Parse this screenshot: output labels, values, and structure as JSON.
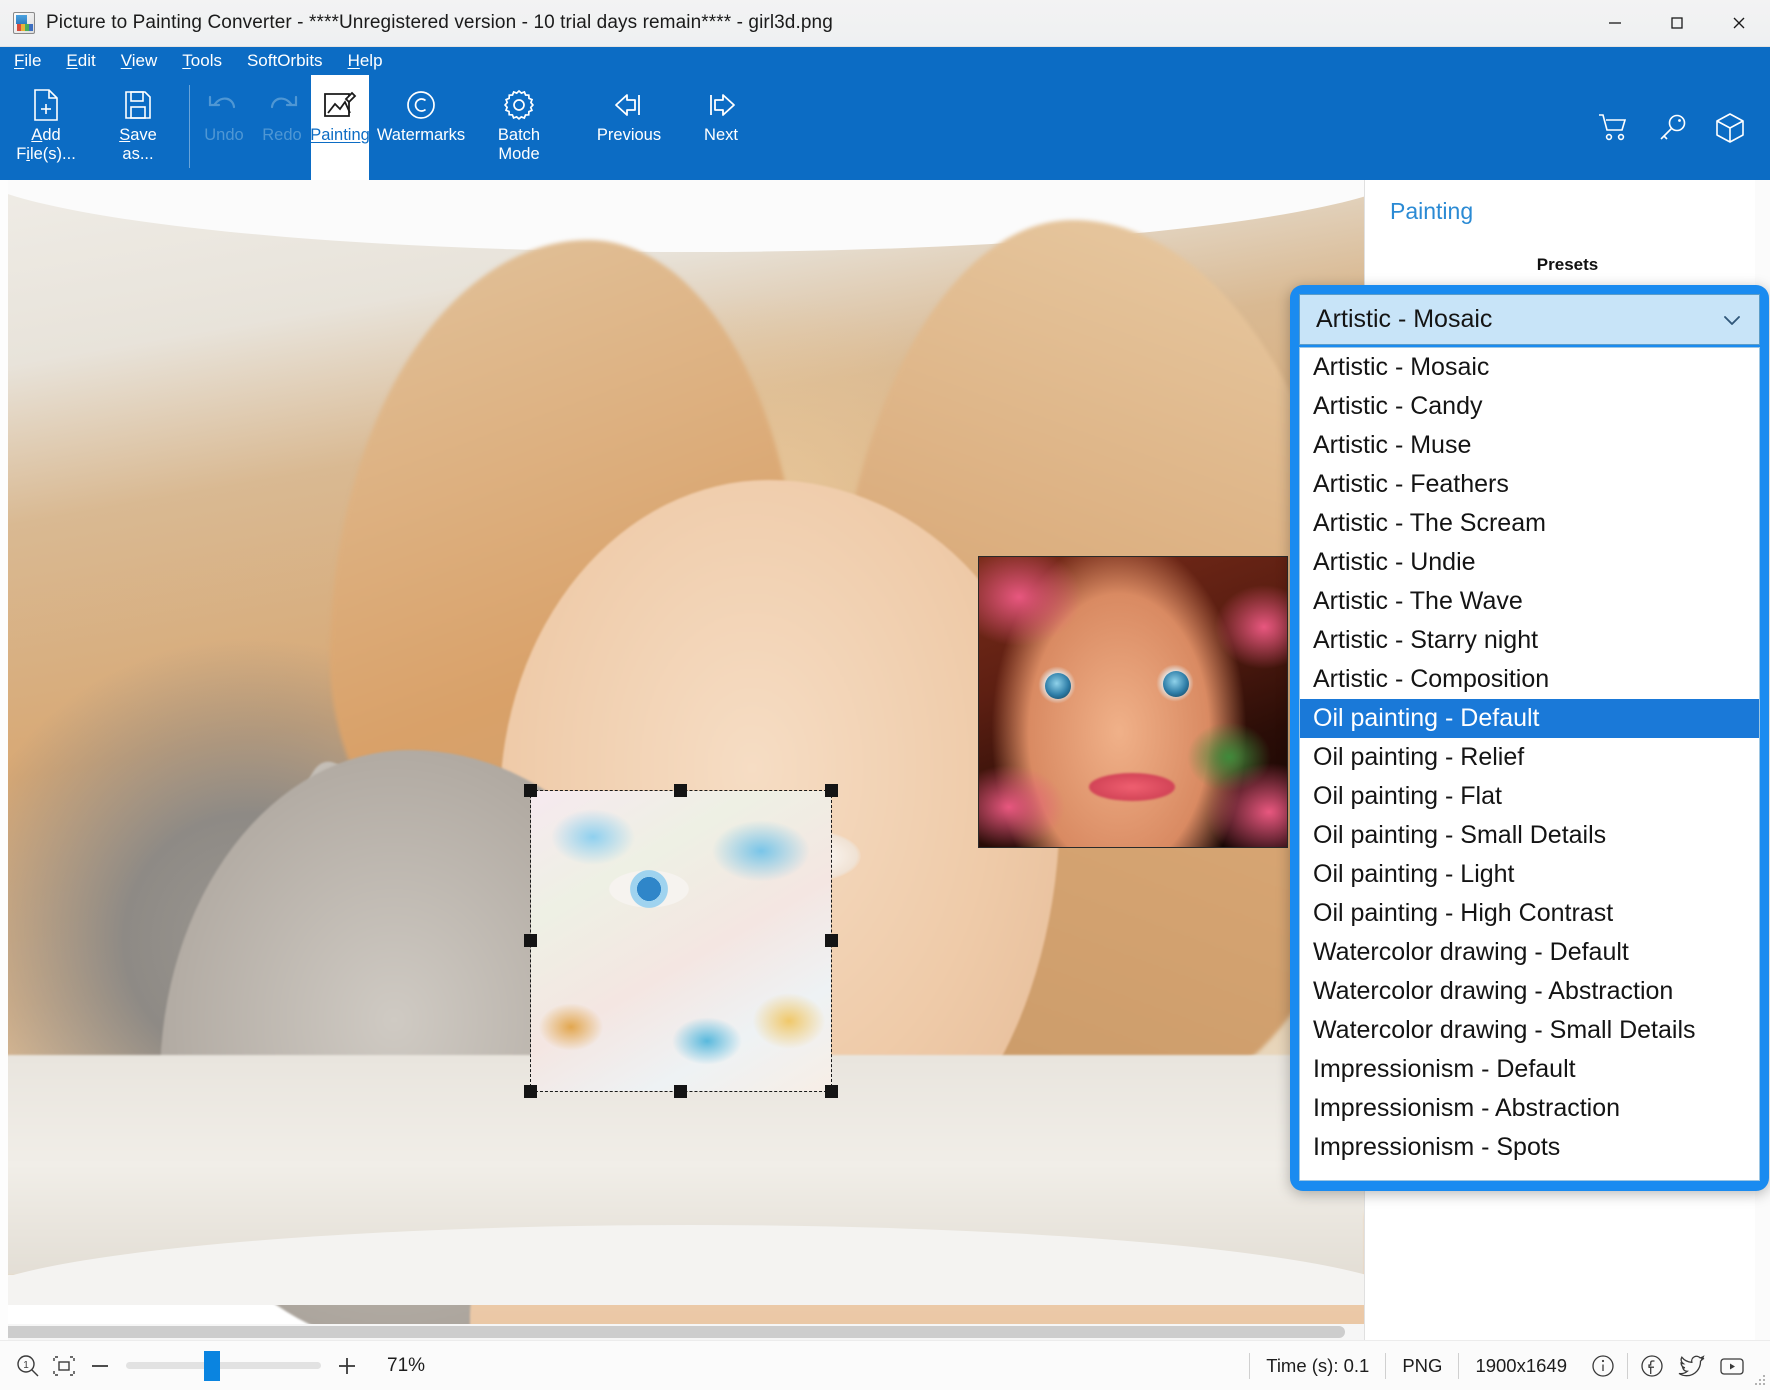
{
  "window": {
    "title": "Picture to Painting Converter - ****Unregistered version - 10 trial days remain**** - girl3d.png",
    "app_icon": "app-icon",
    "controls": {
      "minimize": "minimize-icon",
      "maximize": "maximize-icon",
      "close": "close-icon"
    }
  },
  "menu": [
    {
      "label": "File",
      "accel": "F"
    },
    {
      "label": "Edit",
      "accel": "E"
    },
    {
      "label": "View",
      "accel": "V"
    },
    {
      "label": "Tools",
      "accel": "T"
    },
    {
      "label": "SoftOrbits",
      "accel": ""
    },
    {
      "label": "Help",
      "accel": "H"
    }
  ],
  "toolbar": {
    "buttons": [
      {
        "label": "Add File(s)...",
        "icon": "add-file-icon",
        "state": "enabled"
      },
      {
        "label": "Save as...",
        "icon": "save-icon",
        "state": "enabled"
      },
      {
        "label": "Undo",
        "icon": "undo-icon",
        "state": "disabled"
      },
      {
        "label": "Redo",
        "icon": "redo-icon",
        "state": "disabled"
      },
      {
        "label": "Painting",
        "icon": "painting-icon",
        "state": "active"
      },
      {
        "label": "Watermarks",
        "icon": "copyright-icon",
        "state": "enabled"
      },
      {
        "label": "Batch Mode",
        "icon": "gear-icon",
        "state": "enabled"
      },
      {
        "label": "Previous",
        "icon": "arrow-left-icon",
        "state": "enabled"
      },
      {
        "label": "Next",
        "icon": "arrow-right-icon",
        "state": "enabled"
      }
    ],
    "right_icons": [
      {
        "name": "cart-icon"
      },
      {
        "name": "key-icon"
      },
      {
        "name": "box-icon"
      }
    ]
  },
  "panel": {
    "title": "Painting",
    "presets_label": "Presets"
  },
  "preset_dropdown": {
    "selected": "Artistic - Mosaic",
    "highlighted": "Oil painting - Default",
    "chevron": "chevron-down-icon",
    "options": [
      "Artistic - Mosaic",
      "Artistic - Candy",
      "Artistic - Muse",
      "Artistic - Feathers",
      "Artistic - The Scream",
      "Artistic - Undie",
      "Artistic - The Wave",
      "Artistic - Starry night",
      "Artistic - Composition",
      "Oil painting - Default",
      "Oil painting - Relief",
      "Oil painting - Flat",
      "Oil painting - Small Details",
      "Oil painting - Light",
      "Oil painting - High Contrast",
      "Watercolor drawing - Default",
      "Watercolor drawing - Abstraction",
      "Watercolor drawing - Small Details",
      "Impressionism - Default",
      "Impressionism - Abstraction",
      "Impressionism - Spots"
    ]
  },
  "statusbar": {
    "zoom_icon": "zoom-one-to-one-icon",
    "fit_icon": "fit-to-screen-icon",
    "minus": "−",
    "plus": "+",
    "zoom_percent": "71%",
    "time": "Time (s): 0.1",
    "format": "PNG",
    "dimensions": "1900x1649",
    "info_icon": "info-icon",
    "facebook_icon": "facebook-icon",
    "twitter_icon": "twitter-icon",
    "youtube_icon": "youtube-icon"
  },
  "colors": {
    "accent": "#0c6cc4",
    "dropdown_border": "#1a8bf0",
    "highlight": "#1a79d8",
    "panel_title": "#2a8ad4"
  }
}
